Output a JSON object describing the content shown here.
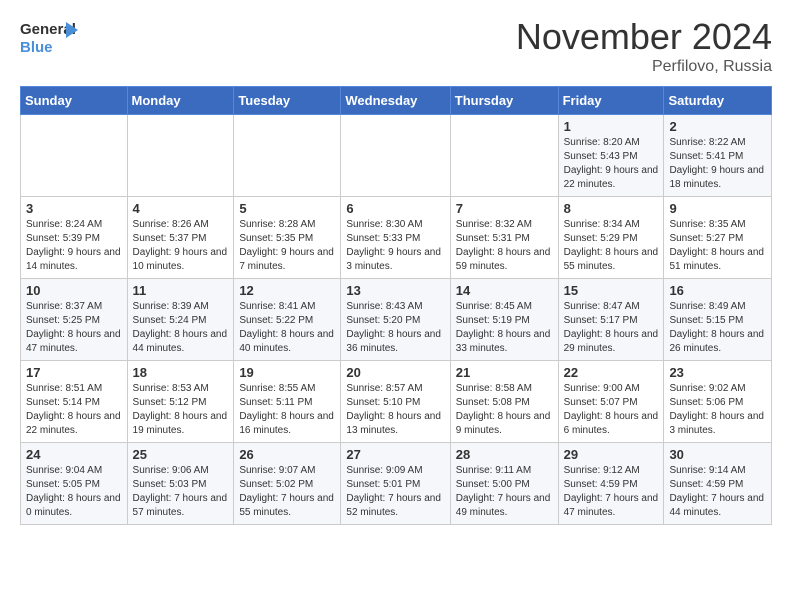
{
  "header": {
    "logo_line1": "General",
    "logo_line2": "Blue",
    "month": "November 2024",
    "location": "Perfilovo, Russia"
  },
  "days_of_week": [
    "Sunday",
    "Monday",
    "Tuesday",
    "Wednesday",
    "Thursday",
    "Friday",
    "Saturday"
  ],
  "weeks": [
    [
      {
        "day": "",
        "info": ""
      },
      {
        "day": "",
        "info": ""
      },
      {
        "day": "",
        "info": ""
      },
      {
        "day": "",
        "info": ""
      },
      {
        "day": "",
        "info": ""
      },
      {
        "day": "1",
        "info": "Sunrise: 8:20 AM\nSunset: 5:43 PM\nDaylight: 9 hours and 22 minutes."
      },
      {
        "day": "2",
        "info": "Sunrise: 8:22 AM\nSunset: 5:41 PM\nDaylight: 9 hours and 18 minutes."
      }
    ],
    [
      {
        "day": "3",
        "info": "Sunrise: 8:24 AM\nSunset: 5:39 PM\nDaylight: 9 hours and 14 minutes."
      },
      {
        "day": "4",
        "info": "Sunrise: 8:26 AM\nSunset: 5:37 PM\nDaylight: 9 hours and 10 minutes."
      },
      {
        "day": "5",
        "info": "Sunrise: 8:28 AM\nSunset: 5:35 PM\nDaylight: 9 hours and 7 minutes."
      },
      {
        "day": "6",
        "info": "Sunrise: 8:30 AM\nSunset: 5:33 PM\nDaylight: 9 hours and 3 minutes."
      },
      {
        "day": "7",
        "info": "Sunrise: 8:32 AM\nSunset: 5:31 PM\nDaylight: 8 hours and 59 minutes."
      },
      {
        "day": "8",
        "info": "Sunrise: 8:34 AM\nSunset: 5:29 PM\nDaylight: 8 hours and 55 minutes."
      },
      {
        "day": "9",
        "info": "Sunrise: 8:35 AM\nSunset: 5:27 PM\nDaylight: 8 hours and 51 minutes."
      }
    ],
    [
      {
        "day": "10",
        "info": "Sunrise: 8:37 AM\nSunset: 5:25 PM\nDaylight: 8 hours and 47 minutes."
      },
      {
        "day": "11",
        "info": "Sunrise: 8:39 AM\nSunset: 5:24 PM\nDaylight: 8 hours and 44 minutes."
      },
      {
        "day": "12",
        "info": "Sunrise: 8:41 AM\nSunset: 5:22 PM\nDaylight: 8 hours and 40 minutes."
      },
      {
        "day": "13",
        "info": "Sunrise: 8:43 AM\nSunset: 5:20 PM\nDaylight: 8 hours and 36 minutes."
      },
      {
        "day": "14",
        "info": "Sunrise: 8:45 AM\nSunset: 5:19 PM\nDaylight: 8 hours and 33 minutes."
      },
      {
        "day": "15",
        "info": "Sunrise: 8:47 AM\nSunset: 5:17 PM\nDaylight: 8 hours and 29 minutes."
      },
      {
        "day": "16",
        "info": "Sunrise: 8:49 AM\nSunset: 5:15 PM\nDaylight: 8 hours and 26 minutes."
      }
    ],
    [
      {
        "day": "17",
        "info": "Sunrise: 8:51 AM\nSunset: 5:14 PM\nDaylight: 8 hours and 22 minutes."
      },
      {
        "day": "18",
        "info": "Sunrise: 8:53 AM\nSunset: 5:12 PM\nDaylight: 8 hours and 19 minutes."
      },
      {
        "day": "19",
        "info": "Sunrise: 8:55 AM\nSunset: 5:11 PM\nDaylight: 8 hours and 16 minutes."
      },
      {
        "day": "20",
        "info": "Sunrise: 8:57 AM\nSunset: 5:10 PM\nDaylight: 8 hours and 13 minutes."
      },
      {
        "day": "21",
        "info": "Sunrise: 8:58 AM\nSunset: 5:08 PM\nDaylight: 8 hours and 9 minutes."
      },
      {
        "day": "22",
        "info": "Sunrise: 9:00 AM\nSunset: 5:07 PM\nDaylight: 8 hours and 6 minutes."
      },
      {
        "day": "23",
        "info": "Sunrise: 9:02 AM\nSunset: 5:06 PM\nDaylight: 8 hours and 3 minutes."
      }
    ],
    [
      {
        "day": "24",
        "info": "Sunrise: 9:04 AM\nSunset: 5:05 PM\nDaylight: 8 hours and 0 minutes."
      },
      {
        "day": "25",
        "info": "Sunrise: 9:06 AM\nSunset: 5:03 PM\nDaylight: 7 hours and 57 minutes."
      },
      {
        "day": "26",
        "info": "Sunrise: 9:07 AM\nSunset: 5:02 PM\nDaylight: 7 hours and 55 minutes."
      },
      {
        "day": "27",
        "info": "Sunrise: 9:09 AM\nSunset: 5:01 PM\nDaylight: 7 hours and 52 minutes."
      },
      {
        "day": "28",
        "info": "Sunrise: 9:11 AM\nSunset: 5:00 PM\nDaylight: 7 hours and 49 minutes."
      },
      {
        "day": "29",
        "info": "Sunrise: 9:12 AM\nSunset: 4:59 PM\nDaylight: 7 hours and 47 minutes."
      },
      {
        "day": "30",
        "info": "Sunrise: 9:14 AM\nSunset: 4:59 PM\nDaylight: 7 hours and 44 minutes."
      }
    ]
  ]
}
